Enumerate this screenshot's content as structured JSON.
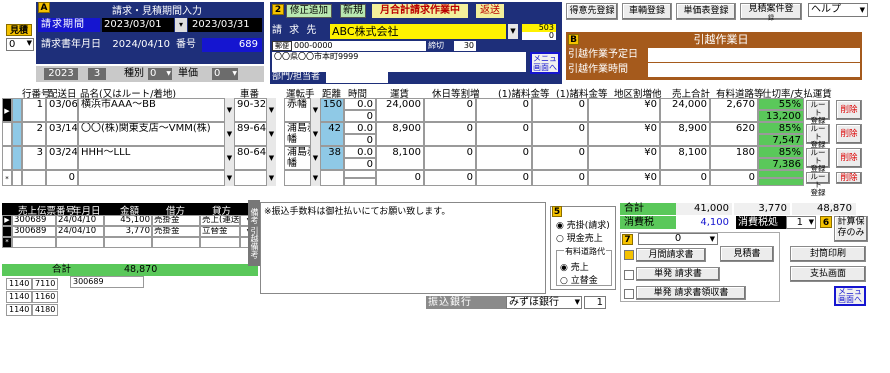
{
  "left_top": {
    "tag": "見積",
    "num": "0"
  },
  "panel_a": {
    "tag": "A",
    "title": "請求・見積期間入力",
    "period_label": "請求期間",
    "date_from": "2023/03/01",
    "date_to": "2023/03/31",
    "issue_label": "請求書年月日",
    "issue_date": "2024/04/10",
    "no_label": "番号",
    "no_value": "689"
  },
  "left_bar": {
    "year": "2023",
    "month": "3",
    "type_label": "種別",
    "type_value": "0",
    "unit_label": "単価",
    "unit_value": "0"
  },
  "panel_2": {
    "tag": "2",
    "add_correct": "修正追加",
    "new_btn": "新規",
    "status": "月合計請求作業中",
    "return_btn": "返送",
    "claim_label": "請 求 先",
    "customer": "ABC株式会社",
    "code": "503",
    "sub_code": "0",
    "postal_tag": "郵便",
    "postal": "000-0000",
    "closing_label": "締切",
    "closing_value": "30",
    "address": "〇〇県〇〇市本町9999",
    "dept_label": "部門/担当者",
    "menu_btn": "メニュ\n画面へ"
  },
  "top_buttons": {
    "b1": "得意先登録",
    "b2": "車輌登録",
    "b3": "単価表登録",
    "b4": "見積案件登",
    "b4_sub": "録",
    "help": "ヘルプ"
  },
  "panel_b": {
    "tag": "B",
    "title": "引越作業日",
    "row1": "引越作業予定日",
    "row2": "引越作業時間"
  },
  "grid": {
    "headers": [
      "行番号",
      "配送日",
      "品名(又はルート/着地)",
      "車番",
      "運転手",
      "距離",
      "時間",
      "運賃",
      "休日等割増",
      "(1)諸料金等",
      "(1)諸料金等",
      "地区割増他",
      "売上合計",
      "有料道路等",
      "仕切率/支払運賃"
    ],
    "rows": [
      {
        "row": "1",
        "day": "03/06",
        "item": "横浜市AAA～BB",
        "car": "90-32",
        "driver": "赤幡",
        "dist": "150",
        "time": "0.0",
        "time2": "0",
        "fare": "24,000",
        "holiday": "0",
        "fee1": "0",
        "fee2": "0",
        "area": "¥0",
        "total": "24,000",
        "toll": "2,670",
        "rate": "55%",
        "rate2": "13,200",
        "route_btn": "ルート\n登録",
        "del_btn": "削除"
      },
      {
        "row": "2",
        "day": "03/14",
        "item": "〇〇(株)関東支店～VMM(株)",
        "car": "89-64",
        "driver": "浦島赤幡",
        "dist": "42",
        "time": "0.0",
        "time2": "0",
        "fare": "8,900",
        "holiday": "0",
        "fee1": "0",
        "fee2": "0",
        "area": "¥0",
        "total": "8,900",
        "toll": "620",
        "rate": "85%",
        "rate2": "7,547",
        "route_btn": "ルート\n登録",
        "del_btn": "削除"
      },
      {
        "row": "3",
        "day": "03/24",
        "item": "HHH～LLL",
        "car": "80-64",
        "driver": "浦島赤幡",
        "dist": "38",
        "time": "0.0",
        "time2": "0",
        "fare": "8,100",
        "holiday": "0",
        "fee1": "0",
        "fee2": "0",
        "area": "¥0",
        "total": "8,100",
        "toll": "180",
        "rate": "85%",
        "rate2": "7,386",
        "route_btn": "ルート\n登録",
        "del_btn": "削除"
      },
      {
        "row": "",
        "day": "0",
        "item": "",
        "car": "",
        "driver": "",
        "dist": "",
        "time": "",
        "time2": "",
        "fare": "0",
        "holiday": "0",
        "fee1": "0",
        "fee2": "0",
        "area": "¥0",
        "total": "0",
        "toll": "0",
        "rate": "",
        "rate2": "",
        "route_btn": "ルート\n登録",
        "del_btn": "削除"
      }
    ]
  },
  "sales_list": {
    "headers": [
      "売上伝票番号",
      "年月日",
      "金額",
      "借方",
      "貸方"
    ],
    "rows": [
      {
        "no": "300689",
        "date": "24/04/10",
        "amount": "45,100",
        "debit": "売掛金",
        "credit": "売上(運送"
      },
      {
        "no": "300689",
        "date": "24/04/10",
        "amount": "3,770",
        "debit": "売掛金",
        "credit": "立替金"
      }
    ],
    "total_label": "合計",
    "total_value": "48,870",
    "slip_no": "300689",
    "codes": [
      [
        "1140",
        "7110"
      ],
      [
        "1140",
        "1160"
      ],
      [
        "1140",
        "4180"
      ]
    ]
  },
  "remarks": {
    "side_label1": "備考",
    "side_label2": "引越備考",
    "text": "※振込手数料は御社払いにてお願い致します。"
  },
  "bank": {
    "label": "振込銀行",
    "value": "みずほ銀行",
    "num": "1"
  },
  "panel_5": {
    "tag": "5",
    "opt1": "売掛(請求)",
    "opt2": "現金売上",
    "group_title": "有料道路代",
    "opt3": "売上",
    "opt4": "立替金"
  },
  "totals": {
    "label": "合計",
    "sum": "41,000",
    "tax_amt": "3,770",
    "grand": "48,870",
    "tax_label": "消費税",
    "tax": "4,100",
    "tax_proc_label": "消費税処理",
    "tax_proc_value": "1"
  },
  "panel_7": {
    "tag": "7",
    "select_value": "0",
    "monthly_btn": "月間請求書",
    "estimate_btn": "見積書",
    "single_btn": "単発 請求書",
    "receipt_btn": "単発 請求書領収書"
  },
  "panel_6": {
    "tag": "6",
    "calc_btn": "計算保\n存のみ"
  },
  "right_buttons": {
    "print": "封筒印刷",
    "pay": "支払画面",
    "menu": "メニュ\n画面へ"
  }
}
